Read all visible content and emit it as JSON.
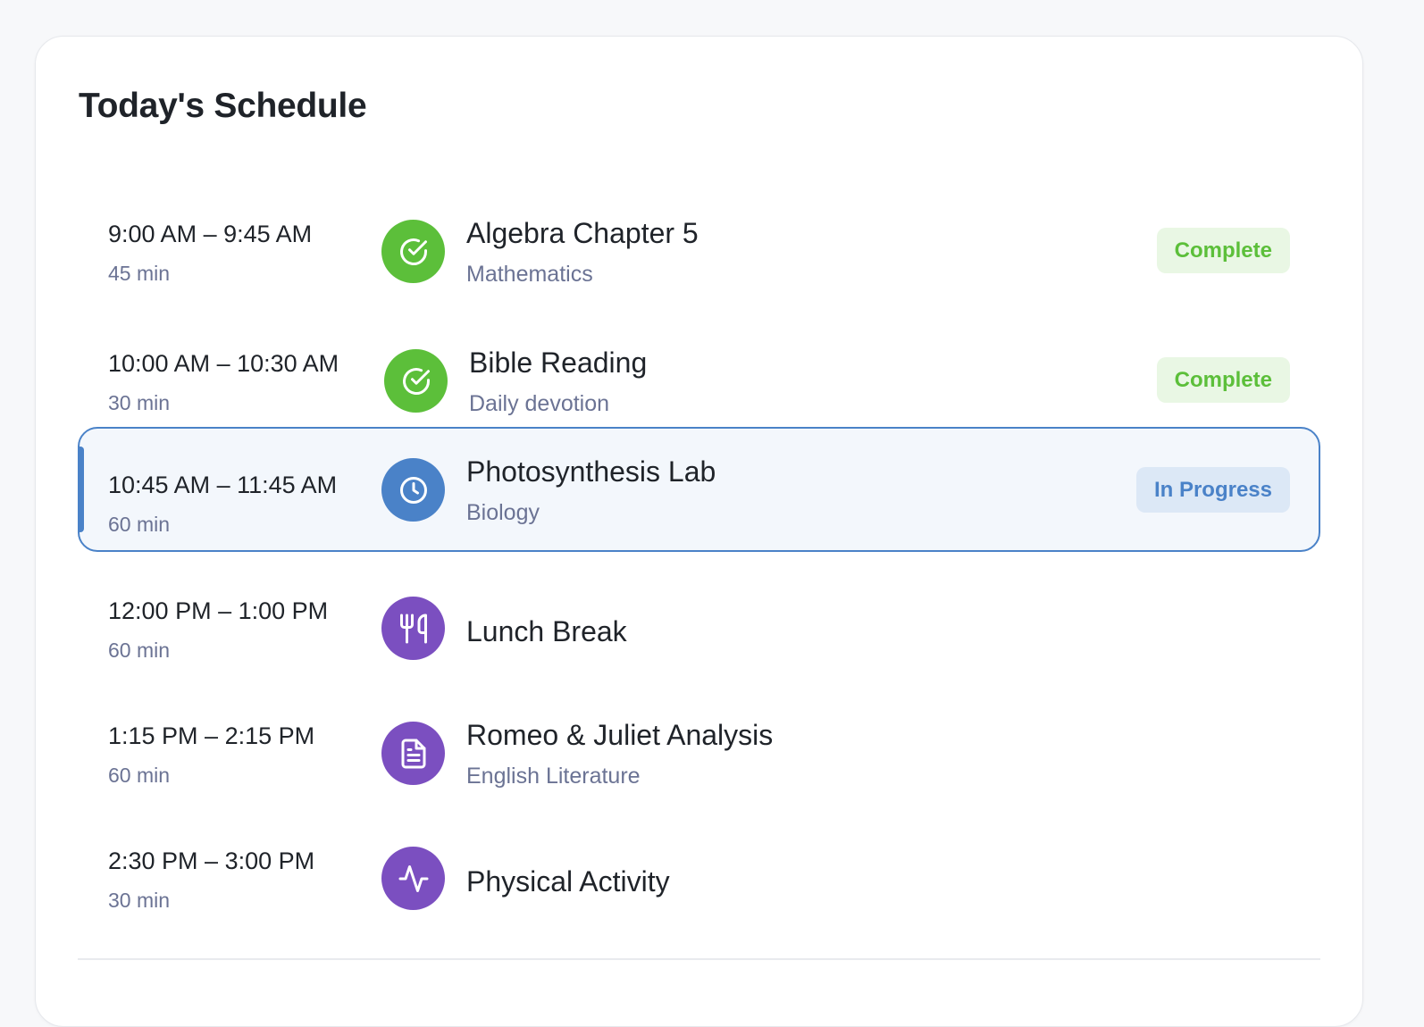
{
  "header": {
    "title": "Today's Schedule"
  },
  "colors": {
    "complete": "#5cbf3a",
    "complete_bg": "#e9f7e4",
    "in_progress": "#4a82c8",
    "in_progress_bg": "#dce8f6",
    "purple": "#7b4fc0"
  },
  "schedule": [
    {
      "time": "9:00 AM – 9:45 AM",
      "duration": "45 min",
      "title": "Algebra Chapter 5",
      "subtitle": "Mathematics",
      "icon": "check-circle-icon",
      "icon_color": "#5cbf3a",
      "status": "Complete"
    },
    {
      "time": "10:00 AM – 10:30 AM",
      "duration": "30 min",
      "title": "Bible Reading",
      "subtitle": "Daily devotion",
      "icon": "check-circle-icon",
      "icon_color": "#5cbf3a",
      "status": "Complete"
    },
    {
      "time": "10:45 AM – 11:45 AM",
      "duration": "60 min",
      "title": "Photosynthesis Lab",
      "subtitle": "Biology",
      "icon": "clock-icon",
      "icon_color": "#4a82c8",
      "status": "In Progress"
    },
    {
      "time": "12:00 PM – 1:00 PM",
      "duration": "60 min",
      "title": "Lunch Break",
      "subtitle": "",
      "icon": "utensils-icon",
      "icon_color": "#7b4fc0",
      "status": ""
    },
    {
      "time": "1:15 PM – 2:15 PM",
      "duration": "60 min",
      "title": "Romeo & Juliet Analysis",
      "subtitle": "English Literature",
      "icon": "document-icon",
      "icon_color": "#7b4fc0",
      "status": ""
    },
    {
      "time": "2:30 PM – 3:00 PM",
      "duration": "30 min",
      "title": "Physical Activity",
      "subtitle": "",
      "icon": "activity-icon",
      "icon_color": "#7b4fc0",
      "status": ""
    }
  ]
}
